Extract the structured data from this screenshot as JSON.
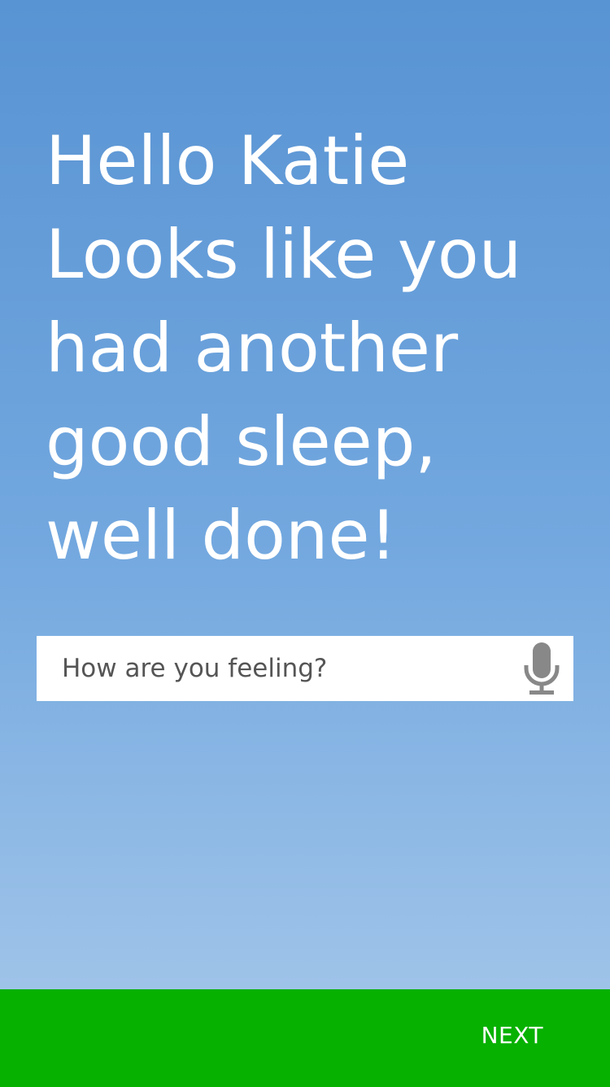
{
  "greeting": {
    "lines": [
      "Hello Katie",
      "Looks like you",
      "had another",
      "good sleep,",
      "well done!"
    ]
  },
  "mood_input": {
    "placeholder": "How are you feeling?",
    "value": "",
    "icon": "microphone-icon"
  },
  "footer": {
    "next_label": "NEXT"
  },
  "colors": {
    "sky_top": "#5893d3",
    "sky_bottom": "#a8c9eb",
    "footer_green": "#07b100",
    "text_white": "#ffffff",
    "icon_gray": "#888888"
  }
}
